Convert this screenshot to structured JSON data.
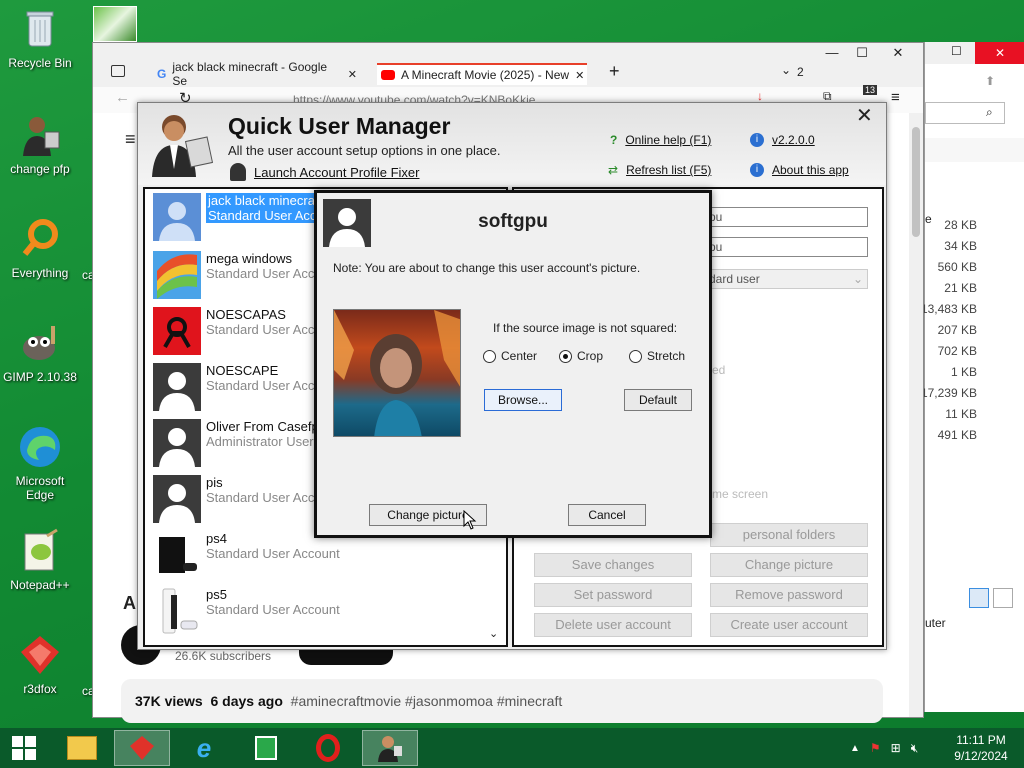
{
  "desktop": {
    "icons": [
      {
        "label": "Recycle Bin"
      },
      {
        "label": "change pfp"
      },
      {
        "label": "Everything"
      },
      {
        "label": "GIMP 2.10.38"
      },
      {
        "label": "Microsoft Edge"
      },
      {
        "label": "Notepad++"
      },
      {
        "label": "r3dfox"
      }
    ],
    "partial_labels": [
      "ca",
      "ca"
    ]
  },
  "browser": {
    "tabs": [
      {
        "title": "jack black minecraft - Google Se",
        "close": "✕"
      },
      {
        "title": "A Minecraft Movie (2025) - New",
        "close": "✕"
      }
    ],
    "new_tab": "+",
    "tab_count": "2",
    "url": "https://www.youtube.com/watch?v=KNBoKkie...",
    "badge": "13",
    "channel_initial": "A",
    "subscribers": "26.6K subscribers",
    "views_line": {
      "views": "37K views",
      "age": "6 days ago",
      "tags": "#aminecraftmovie #jasonmomoa #minecraft"
    }
  },
  "explorer": {
    "sizes": [
      "28 KB",
      "34 KB",
      "560 KB",
      "21 KB",
      "13,483 KB",
      "207 KB",
      "702 KB",
      "1 KB",
      "17,239 KB",
      "11 KB",
      "491 KB"
    ],
    "partial_top": "e",
    "partial_bottom": "uter"
  },
  "qum": {
    "title": "Quick User Manager",
    "subtitle": "All the user account setup options in one place.",
    "launch_link": "Launch Account Profile Fixer",
    "online_help": "Online help (F1)",
    "refresh": "Refresh list (F5)",
    "version": "v2.2.0.0",
    "about": "About this app",
    "users": [
      {
        "name": "jack black minecra",
        "type": "Standard User Acc",
        "selected": true
      },
      {
        "name": "mega windows",
        "type": "Standard User Accc"
      },
      {
        "name": "NOESCAPAS",
        "type": "Standard User Accc"
      },
      {
        "name": "NOESCAPE",
        "type": "Standard User Accc"
      },
      {
        "name": "Oliver From Casefp",
        "type": "Administrator User"
      },
      {
        "name": "pis",
        "type": "Standard User Accc"
      },
      {
        "name": "ps4",
        "type": "Standard User Account"
      },
      {
        "name": "ps5",
        "type": "Standard User Account"
      }
    ],
    "right": {
      "field1": "pu",
      "field2": "pu",
      "account_type": "dard user",
      "partial_ed": "ed",
      "partial_welcome": "me screen",
      "personal_folders": "personal folders",
      "save_changes": "Save changes",
      "change_picture": "Change picture",
      "set_password": "Set password",
      "remove_password": "Remove password",
      "delete_account": "Delete user account",
      "create_account": "Create user account"
    }
  },
  "dialog": {
    "username": "softgpu",
    "note": "Note: You are about to change this user account's picture.",
    "source_label": "If the source image is not squared:",
    "options": [
      {
        "label": "Center",
        "checked": false
      },
      {
        "label": "Crop",
        "checked": true
      },
      {
        "label": "Stretch",
        "checked": false
      }
    ],
    "browse": "Browse...",
    "default": "Default",
    "change_picture": "Change picture",
    "cancel": "Cancel"
  },
  "taskbar": {
    "time": "11:11 PM",
    "date": "9/12/2024"
  },
  "colors": {
    "desktop_green": "#128a33",
    "selection_blue": "#3399ff",
    "youtube_red": "#ff0000"
  }
}
